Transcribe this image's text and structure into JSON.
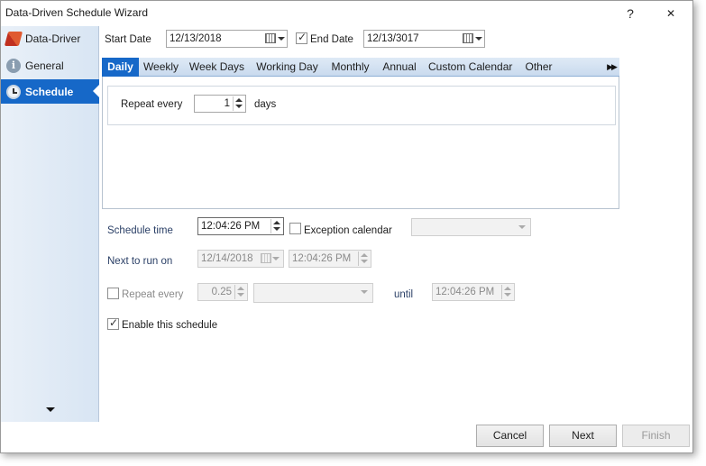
{
  "window": {
    "title": "Data-Driven Schedule Wizard",
    "help_label": "?",
    "close_label": "✕"
  },
  "sidebar": {
    "items": [
      {
        "label": "Data-Driver",
        "icon": "data-driver-icon",
        "active": false
      },
      {
        "label": "General",
        "icon": "info-icon",
        "active": false
      },
      {
        "label": "Schedule",
        "icon": "clock-icon",
        "active": true
      }
    ]
  },
  "dates": {
    "start_label": "Start Date",
    "start_value": "12/13/2018",
    "end_checked": true,
    "end_label": "End Date",
    "end_value": "12/13/3017"
  },
  "tabs": [
    {
      "label": "Daily",
      "active": true
    },
    {
      "label": "Weekly",
      "active": false
    },
    {
      "label": "Week Days",
      "active": false
    },
    {
      "label": "Working Day",
      "active": false
    },
    {
      "label": "Monthly",
      "active": false
    },
    {
      "label": "Annual",
      "active": false
    },
    {
      "label": "Custom Calendar",
      "active": false
    },
    {
      "label": "Other",
      "active": false
    }
  ],
  "daily": {
    "repeat_label": "Repeat every",
    "repeat_value": "1",
    "unit_label": "days"
  },
  "schedule": {
    "time_label": "Schedule time",
    "time_value": "12:04:26 PM",
    "exception_checked": false,
    "exception_label": "Exception calendar",
    "exception_value": "",
    "next_label": "Next to run on",
    "next_date": "12/14/2018",
    "next_time": "12:04:26 PM",
    "repeat_checked": false,
    "repeat_label": "Repeat every",
    "repeat_value": "0.25",
    "repeat_unit": "",
    "until_label": "until",
    "until_value": "12:04:26 PM",
    "enable_checked": true,
    "enable_label": "Enable this schedule"
  },
  "footer": {
    "cancel_label": "Cancel",
    "next_label": "Next",
    "finish_label": "Finish"
  },
  "colors": {
    "accent": "#1668c8",
    "sidebar_bg": "#e1ebf6"
  }
}
